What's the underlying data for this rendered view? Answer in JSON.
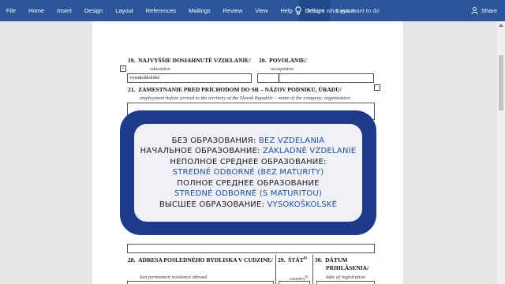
{
  "ribbon": {
    "tabs": [
      "File",
      "Home",
      "Insert",
      "Design",
      "Layout",
      "References",
      "Mailings",
      "Review",
      "View",
      "Help",
      "Design",
      "Layout"
    ],
    "active_tab_index": 10,
    "tell_me_placeholder": "Tell me what you want to do",
    "share_label": "Share",
    "bg_color": "#2b579a"
  },
  "form": {
    "row19": {
      "num": "19.",
      "label": "NAJVYŠŠIE DOSIAHNUTÉ VZDELANIE/",
      "sub": "education",
      "value": "vysokoškolské"
    },
    "row20": {
      "num": "20.",
      "label": "POVOLANIE/",
      "sub": "occupation"
    },
    "row21": {
      "num": "21.",
      "label": "ZAMESTNANIE PRED PRÍCHODOM DO SR – NÁZOV PODNIKU, ÚRADU/",
      "sub": "employment before arrival to the territory of the Slovak Republic – name of the company, organisation"
    },
    "row28": {
      "num": "28.",
      "label": "ADRESA POSLEDNÉHO BYDLISKA V CUDZINE/",
      "sub": "last permanent residence abroad"
    },
    "row29": {
      "num": "29.",
      "label": "ŠTÁT",
      "sup": "8)",
      "sub": "country",
      "sub_sup": "8)"
    },
    "row30": {
      "num": "30.",
      "label": "DÁTUM",
      "label2": "PRIHLÁSENIA/",
      "sub": "date of registration"
    }
  },
  "overlay": {
    "lines": [
      {
        "prefix": "БЕЗ ОБРАЗОВАНИЯ: ",
        "value": "BEZ VZDELANIA"
      },
      {
        "prefix": "НАЧАЛЬНОЕ ОБРАЗОВАНИЕ: ",
        "value": "ZÁKLADNÉ VZDELANIE"
      },
      {
        "prefix": "НЕПОЛНОЕ СРЕДНЕЕ ОБРАЗОВАНИЕ:",
        "value": ""
      },
      {
        "prefix": "",
        "value": "STREDNÉ ODBORNÉ (BEZ MATURITY)"
      },
      {
        "prefix": "ПОЛНОЕ СРЕДНЕЕ ОБРАЗОВАНИЕ",
        "value": ""
      },
      {
        "prefix": "",
        "value": "STREDNÉ ODBORNÉ (S MATURITOU)"
      },
      {
        "prefix": "ВЫСШЕЕ ОБРАЗОВАНИЕ: ",
        "value": "VYSOKOŠKOLSKÉ"
      }
    ],
    "frame_color": "#1d3b8a",
    "accent_color": "#1d4fa6"
  }
}
